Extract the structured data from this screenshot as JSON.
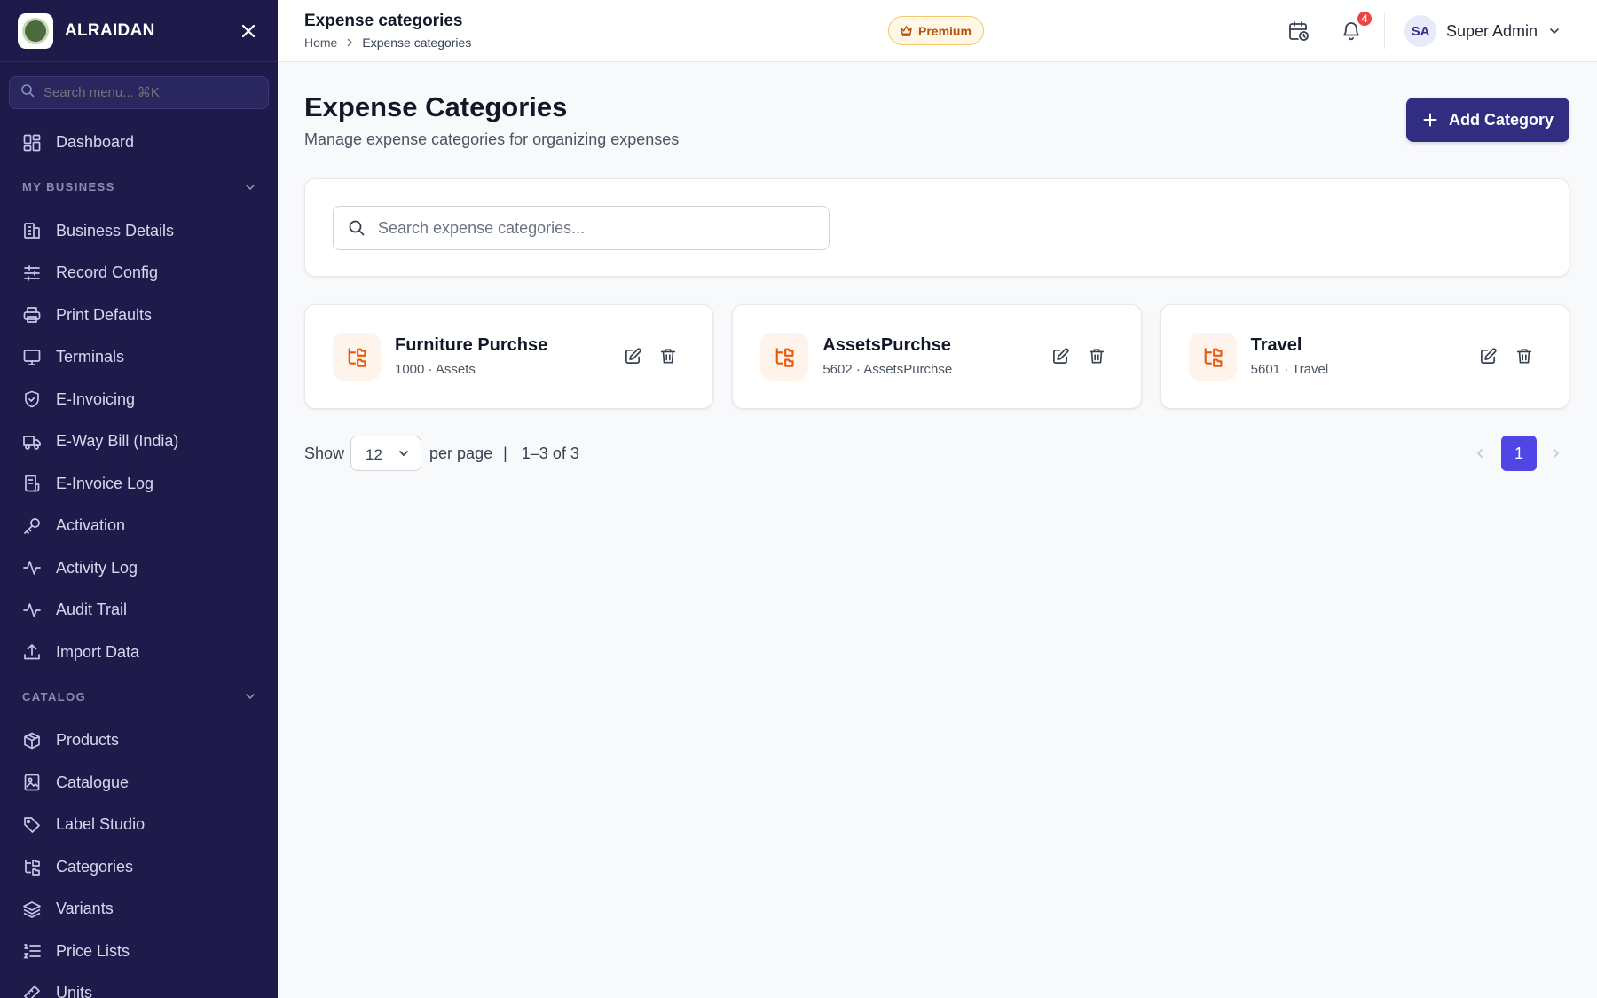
{
  "brand": {
    "name": "ALRAIDAN"
  },
  "sidebar": {
    "search_placeholder": "Search menu... ⌘K",
    "dashboard": {
      "label": "Dashboard",
      "icon": "dashboard-icon"
    },
    "sections": [
      {
        "title": "MY BUSINESS",
        "items": [
          {
            "label": "Business Details",
            "icon": "building-icon"
          },
          {
            "label": "Record Config",
            "icon": "sliders-icon"
          },
          {
            "label": "Print Defaults",
            "icon": "printer-icon"
          },
          {
            "label": "Terminals",
            "icon": "monitor-icon"
          },
          {
            "label": "E-Invoicing",
            "icon": "shield-check-icon"
          },
          {
            "label": "E-Way Bill (India)",
            "icon": "truck-icon"
          },
          {
            "label": "E-Invoice Log",
            "icon": "receipt-icon"
          },
          {
            "label": "Activation",
            "icon": "key-icon"
          },
          {
            "label": "Activity Log",
            "icon": "activity-icon"
          },
          {
            "label": "Audit Trail",
            "icon": "activity-icon"
          },
          {
            "label": "Import Data",
            "icon": "upload-icon"
          }
        ]
      },
      {
        "title": "CATALOG",
        "items": [
          {
            "label": "Products",
            "icon": "package-icon"
          },
          {
            "label": "Catalogue",
            "icon": "image-book-icon"
          },
          {
            "label": "Label Studio",
            "icon": "tag-icon"
          },
          {
            "label": "Categories",
            "icon": "folder-tree-icon"
          },
          {
            "label": "Variants",
            "icon": "layers-icon"
          },
          {
            "label": "Price Lists",
            "icon": "list-ordered-icon"
          },
          {
            "label": "Units",
            "icon": "ruler-icon"
          }
        ]
      }
    ]
  },
  "header": {
    "title": "Expense categories",
    "breadcrumb": [
      "Home",
      "Expense categories"
    ],
    "premium_label": "Premium",
    "notification_count": "4",
    "user": {
      "initials": "SA",
      "name": "Super Admin"
    }
  },
  "main": {
    "title": "Expense Categories",
    "subtitle": "Manage expense categories for organizing expenses",
    "add_button": "Add Category",
    "search_placeholder": "Search expense categories...",
    "categories": [
      {
        "name": "Furniture Purchse",
        "meta": "1000 · Assets"
      },
      {
        "name": "AssetsPurchse",
        "meta": "5602 · AssetsPurchse"
      },
      {
        "name": "Travel",
        "meta": "5601 · Travel"
      }
    ],
    "pagination": {
      "show_label": "Show",
      "per_page_value": "12",
      "per_page_label": "per page",
      "separator": "|",
      "range": "1–3 of 3",
      "current_page": "1"
    }
  },
  "colors": {
    "sidebar_bg": "#1e1b4b",
    "primary": "#312e81",
    "page_active": "#4f46e5",
    "category_icon": "#ea580c",
    "badge": "#ef4444"
  }
}
